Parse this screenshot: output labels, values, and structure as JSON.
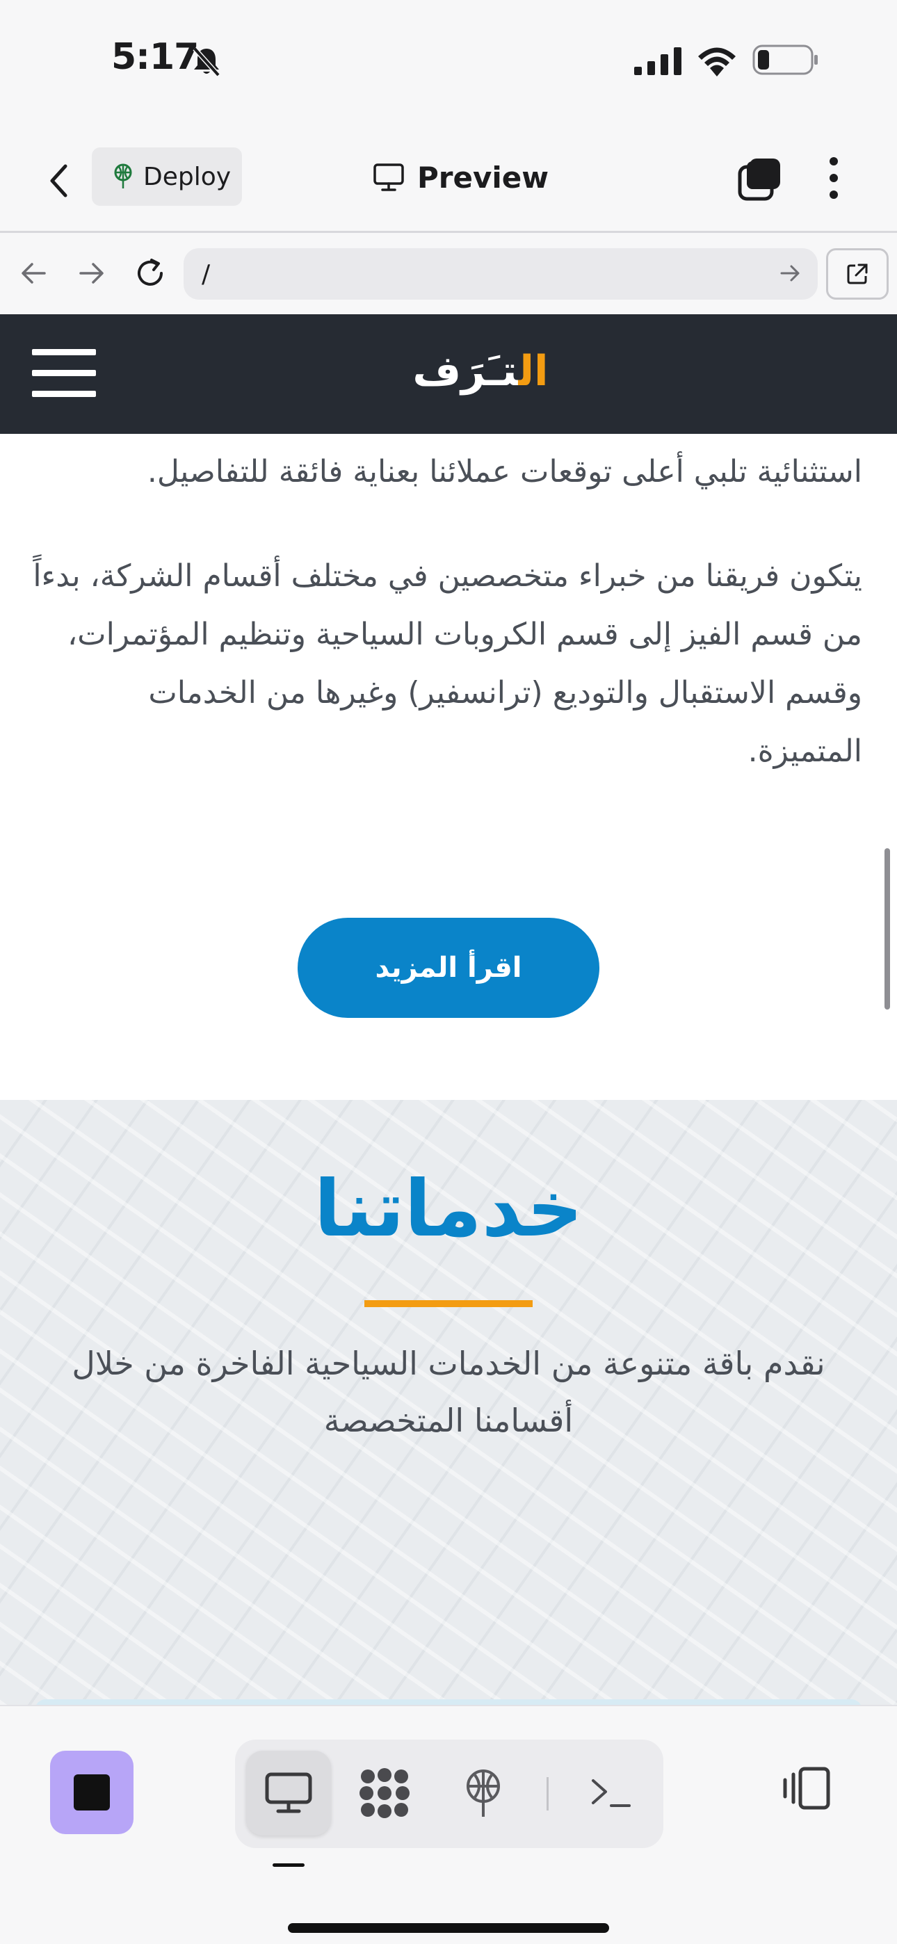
{
  "status_bar": {
    "time": "5:17"
  },
  "app_header": {
    "deploy_label": "Deploy",
    "preview_label": "Preview"
  },
  "browser": {
    "url": "/"
  },
  "site": {
    "logo_al": "ال",
    "logo_rest": "تـَرَف",
    "about_paragraphs": [
      "استثنائية تلبي أعلى توقعات عملائنا بعناية فائقة للتفاصيل.",
      "يتكون فريقنا من خبراء متخصصين في مختلف أقسام الشركة، بدءاً من قسم الفيز إلى قسم الكروبات السياحية وتنظيم المؤتمرات، وقسم الاستقبال والتوديع (ترانسفير) وغيرها من الخدمات المتميزة."
    ],
    "read_more_label": "اقرأ المزيد",
    "services_title": "خدماتنا",
    "services_desc": "نقدم باقة متنوعة من الخدمات السياحية الفاخرة من خلال أقسامنا المتخصصة"
  },
  "colors": {
    "brand_blue": "#0a84c9",
    "brand_orange": "#f39c12",
    "nav_dark": "#262b33",
    "stop_purple": "#b7a5f7"
  },
  "icons": {
    "header": [
      "chevron-left-icon",
      "deploy-globe-icon",
      "monitor-icon",
      "tabs-icon",
      "more-vertical-icon"
    ],
    "browser": [
      "arrow-left-icon",
      "arrow-right-icon",
      "reload-icon",
      "go-arrow-icon",
      "open-external-icon"
    ],
    "bottom": [
      "stop-icon",
      "monitor-icon",
      "apps-grid-icon",
      "deploy-globe-icon",
      "terminal-icon",
      "device-toggle-icon"
    ]
  }
}
